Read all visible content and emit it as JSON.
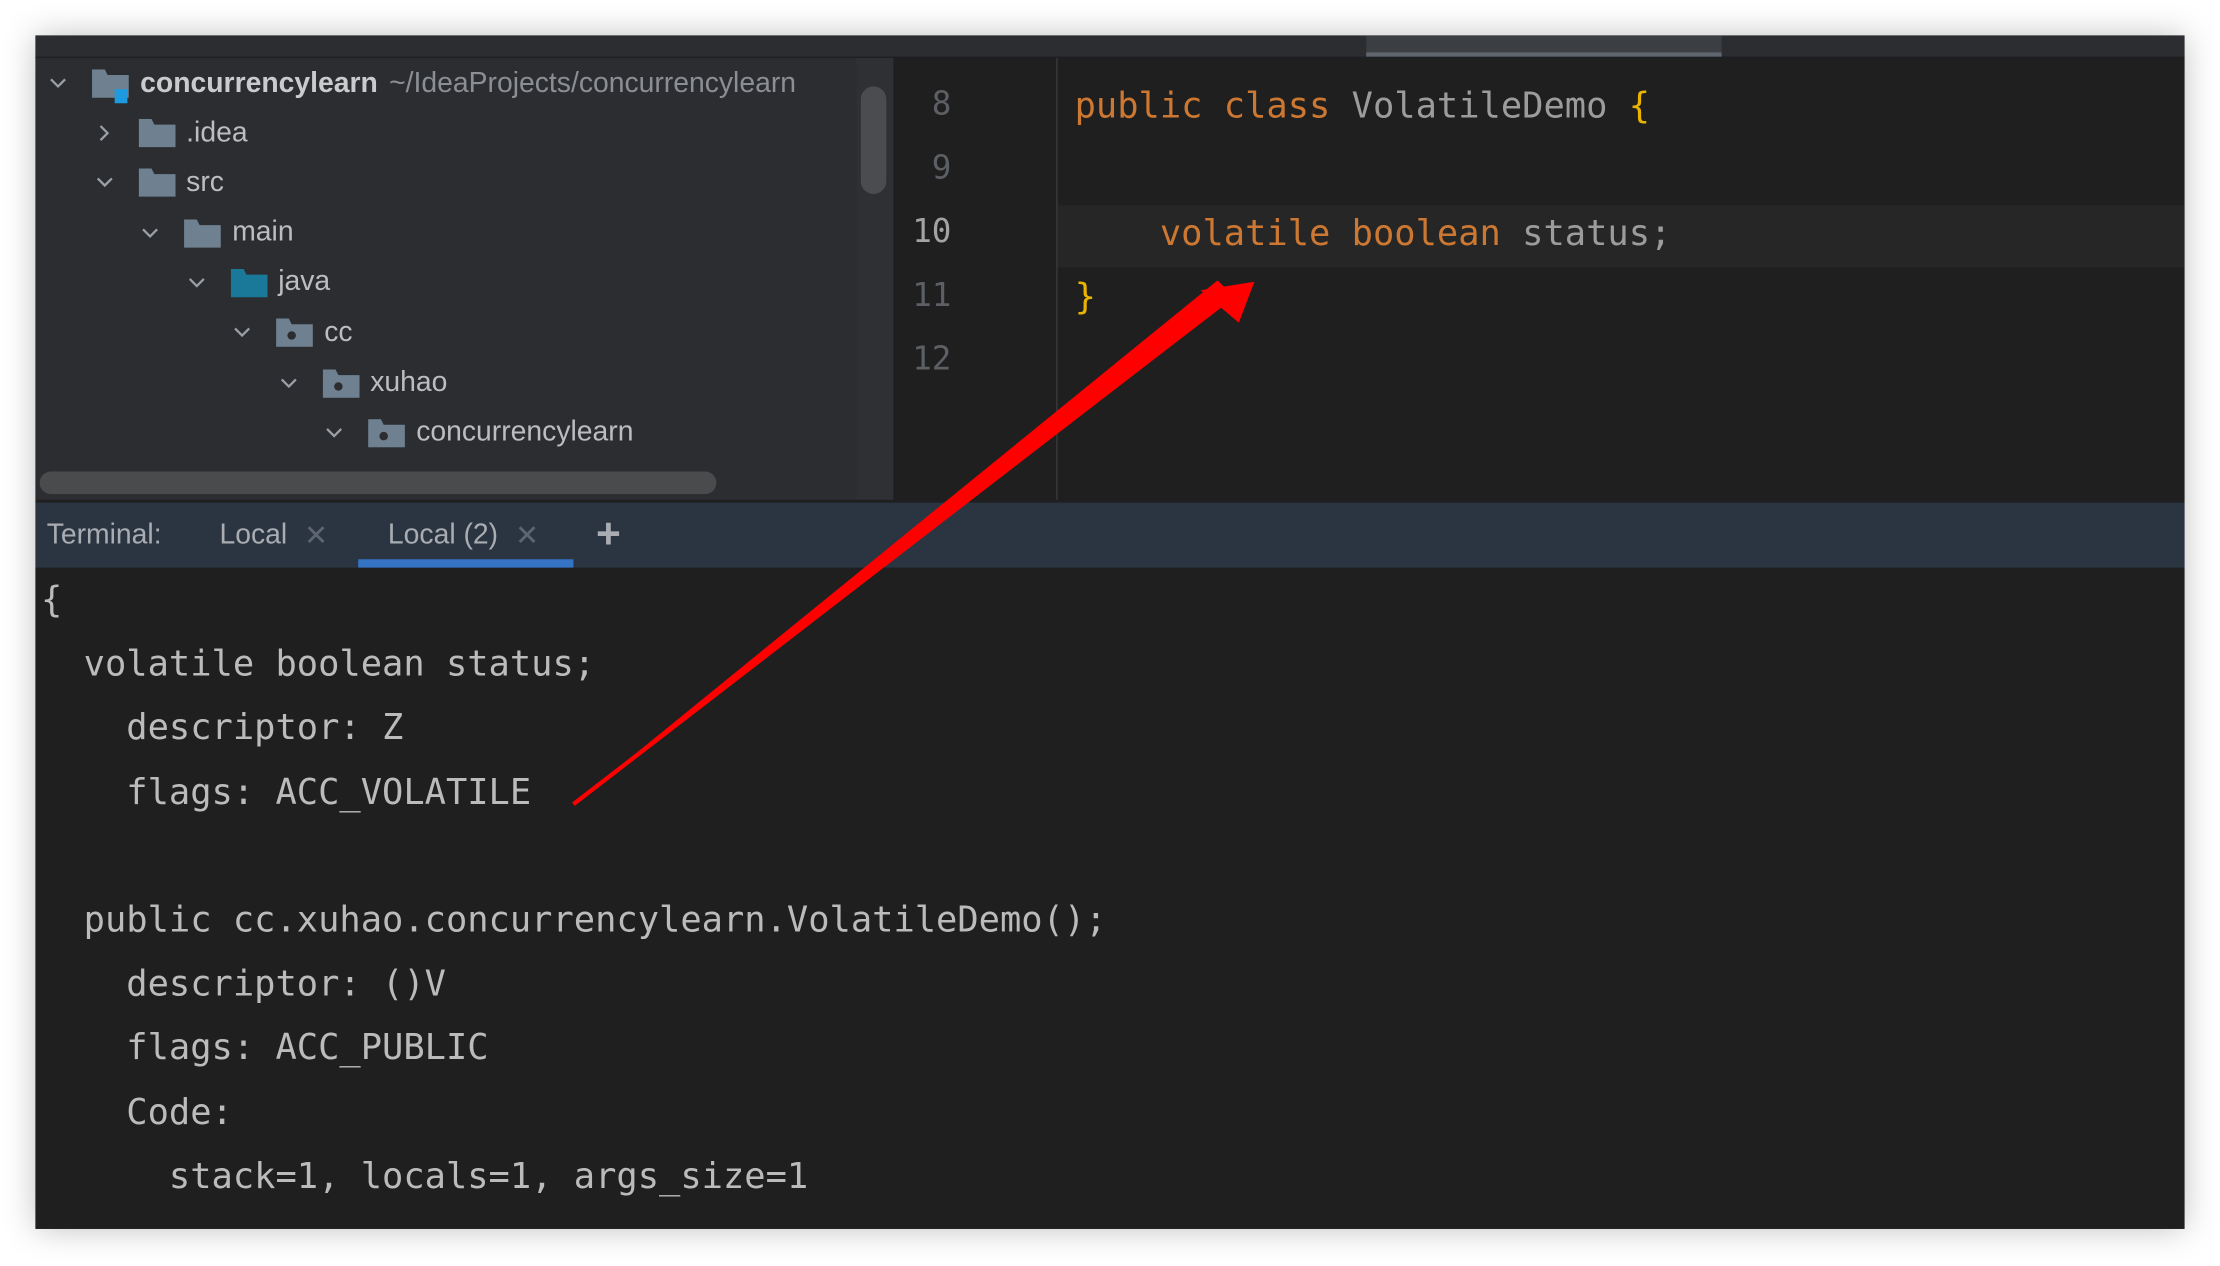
{
  "project_tree": {
    "root": {
      "name": "concurrencylearn",
      "path": "~/IdeaProjects/concurrencylearn"
    },
    "items": [
      {
        "name": ".idea",
        "expanded": false,
        "icon": "folder-icon"
      },
      {
        "name": "src",
        "expanded": true,
        "icon": "folder-icon"
      },
      {
        "name": "main",
        "expanded": true,
        "icon": "folder-icon"
      },
      {
        "name": "java",
        "expanded": true,
        "icon": "source-folder-icon"
      },
      {
        "name": "cc",
        "expanded": true,
        "icon": "package-icon"
      },
      {
        "name": "xuhao",
        "expanded": true,
        "icon": "package-icon"
      },
      {
        "name": "concurrencylearn",
        "expanded": true,
        "icon": "package-icon"
      }
    ]
  },
  "editor": {
    "line_numbers": [
      "8",
      "9",
      "10",
      "11",
      "12"
    ],
    "current_line": "10",
    "lines": {
      "l8_kw1": "public",
      "l8_kw2": "class",
      "l8_name": "VolatileDemo",
      "l8_brace": "{",
      "l10_kw1": "volatile",
      "l10_kw2": "boolean",
      "l10_field": "status;",
      "l11_brace": "}"
    }
  },
  "terminal": {
    "label": "Terminal:",
    "tabs": [
      {
        "label": "Local",
        "active": false
      },
      {
        "label": "Local (2)",
        "active": true
      }
    ],
    "close_glyph": "✕",
    "add_glyph": "+",
    "output": [
      "{",
      "  volatile boolean status;",
      "    descriptor: Z",
      "    flags: ACC_VOLATILE",
      "",
      "  public cc.xuhao.concurrencylearn.VolatileDemo();",
      "    descriptor: ()V",
      "    flags: ACC_PUBLIC",
      "    Code:",
      "      stack=1, locals=1, args_size=1"
    ]
  },
  "colors": {
    "keyword": "#cc7832",
    "brace": "#e8b400",
    "arrow": "#ff0000",
    "tab_underline": "#3574c4"
  }
}
